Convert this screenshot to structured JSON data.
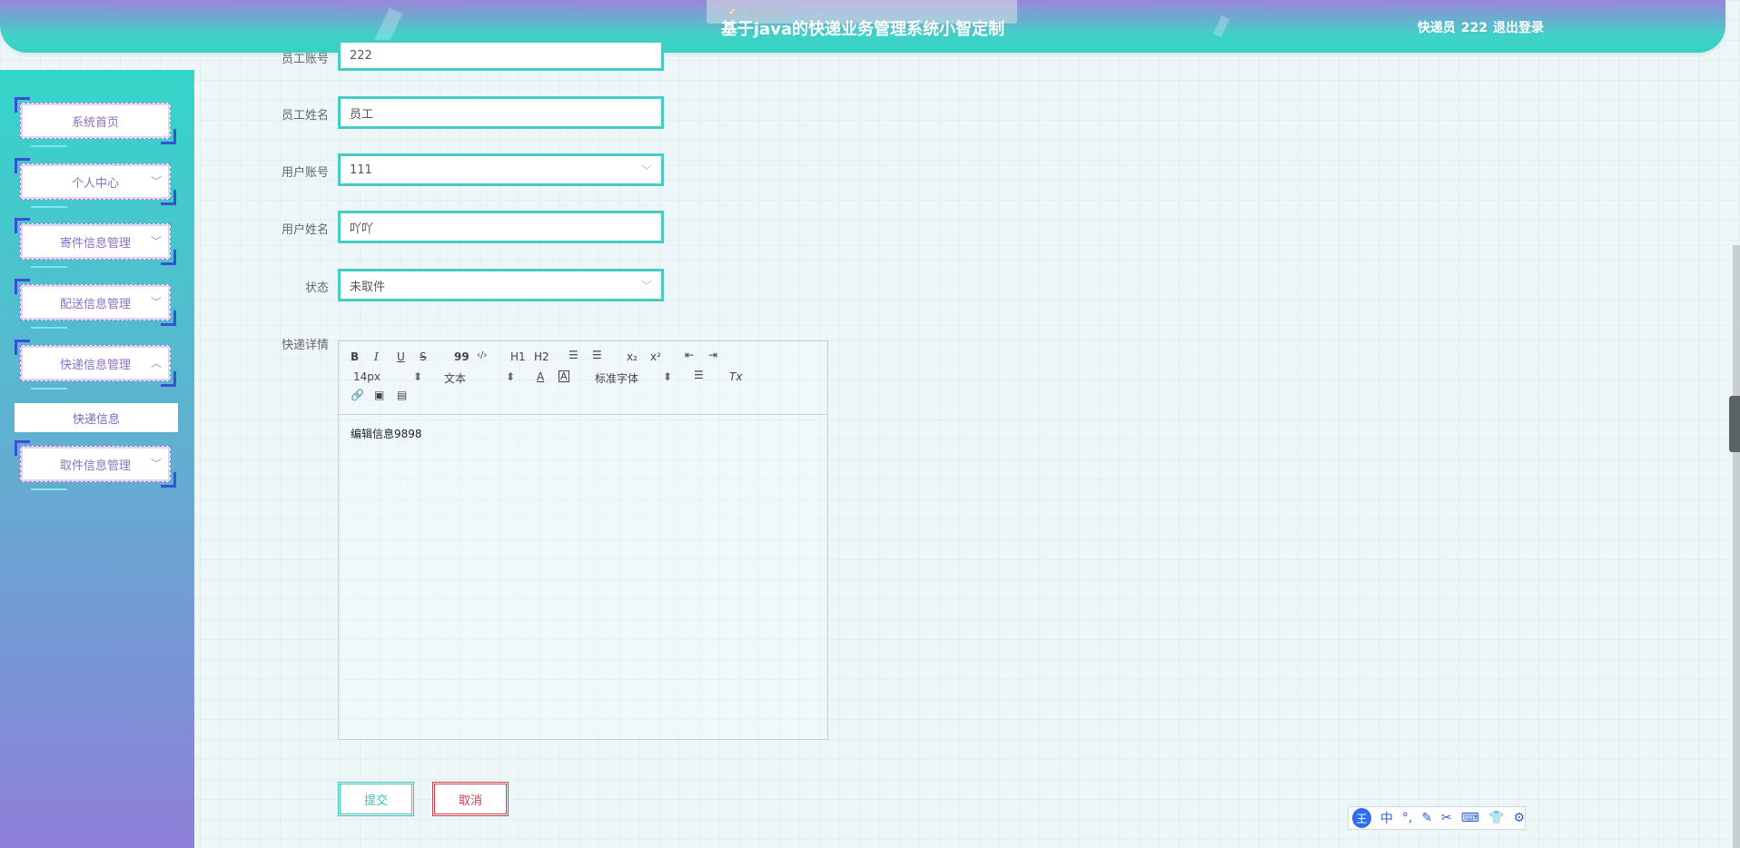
{
  "header": {
    "title": "基于java的快递业务管理系统小智定制",
    "toast": "操作成功",
    "user_role": "快递员",
    "user_name": "222",
    "logout": "退出登录"
  },
  "sidebar": {
    "items": [
      {
        "label": "系统首页"
      },
      {
        "label": "个人中心"
      },
      {
        "label": "寄件信息管理"
      },
      {
        "label": "配送信息管理"
      },
      {
        "label": "快递信息管理"
      },
      {
        "label": "取件信息管理"
      }
    ],
    "submenu": "快递信息"
  },
  "form": {
    "employee_account": {
      "label": "员工账号",
      "value": "222"
    },
    "employee_name": {
      "label": "员工姓名",
      "value": "员工"
    },
    "user_account": {
      "label": "用户账号",
      "value": "111"
    },
    "user_name": {
      "label": "用户姓名",
      "value": "吖吖"
    },
    "status": {
      "label": "状态",
      "value": "未取件"
    },
    "details": {
      "label": "快递详情",
      "content": "编辑信息9898"
    }
  },
  "editor_toolbar": {
    "bold": "B",
    "italic": "I",
    "underline": "U",
    "strike": "S",
    "quote": "99",
    "code": "‹/›",
    "h1": "H1",
    "h2": "H2",
    "sub": "x₂",
    "sup": "x²",
    "size": "14px",
    "type": "文本",
    "font": "标准字体",
    "clear": "Tx"
  },
  "buttons": {
    "submit": "提交",
    "cancel": "取消"
  },
  "ime": {
    "logo": "王",
    "mode": "中"
  }
}
